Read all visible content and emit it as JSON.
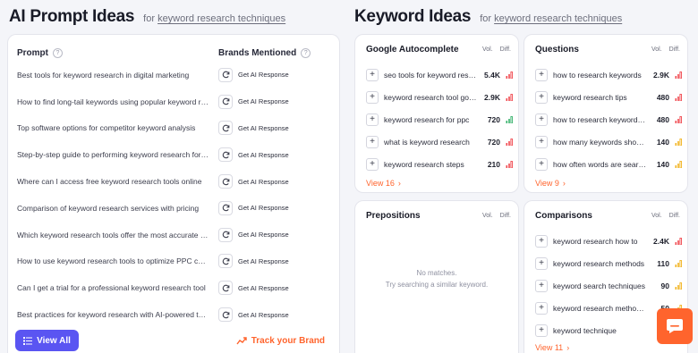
{
  "ai_prompt": {
    "title": "AI Prompt Ideas",
    "for_prefix": "for",
    "keyword": "keyword research techniques",
    "col_prompt": "Prompt",
    "col_brands": "Brands Mentioned",
    "get_response": "Get AI Response",
    "rows": [
      "Best tools for keyword research in digital marketing",
      "How to find long-tail keywords using popular keyword research tools",
      "Top software options for competitor keyword analysis",
      "Step-by-step guide to performing keyword research for SEO",
      "Where can I access free keyword research tools online",
      "Comparison of keyword research services with pricing",
      "Which keyword research tools offer the most accurate data",
      "How to use keyword research tools to optimize PPC campaigns",
      "Can I get a trial for a professional keyword research tool",
      "Best practices for keyword research with AI-powered tools"
    ],
    "view_all": "View All",
    "track_brand": "Track your Brand"
  },
  "keyword_ideas": {
    "title": "Keyword Ideas",
    "for_prefix": "for",
    "keyword": "keyword research techniques",
    "vol_label": "Vol.",
    "diff_label": "Diff.",
    "cards": {
      "autocomplete": {
        "title": "Google Autocomplete",
        "rows": [
          {
            "kw": "seo tools for keyword research",
            "vol": "5.4K",
            "diff": "red"
          },
          {
            "kw": "keyword research tool google",
            "vol": "2.9K",
            "diff": "red"
          },
          {
            "kw": "keyword research for ppc",
            "vol": "720",
            "diff": "green"
          },
          {
            "kw": "what is keyword research",
            "vol": "720",
            "diff": "red"
          },
          {
            "kw": "keyword research steps",
            "vol": "210",
            "diff": "red"
          }
        ],
        "view_more": "View 16"
      },
      "questions": {
        "title": "Questions",
        "rows": [
          {
            "kw": "how to research keywords",
            "vol": "2.9K",
            "diff": "red"
          },
          {
            "kw": "keyword research tips",
            "vol": "480",
            "diff": "red"
          },
          {
            "kw": "how to research keywords for seo",
            "vol": "480",
            "diff": "red"
          },
          {
            "kw": "how many keywords should i use",
            "vol": "140",
            "diff": "yellow"
          },
          {
            "kw": "how often words are searched",
            "vol": "140",
            "diff": "yellow"
          }
        ],
        "view_more": "View 9"
      },
      "prepositions": {
        "title": "Prepositions",
        "no_matches": "No matches.",
        "try_similar": "Try searching a similar keyword."
      },
      "comparisons": {
        "title": "Comparisons",
        "rows": [
          {
            "kw": "keyword research how to",
            "vol": "2.4K",
            "diff": "red"
          },
          {
            "kw": "keyword research methods",
            "vol": "110",
            "diff": "yellow"
          },
          {
            "kw": "keyword search techniques",
            "vol": "90",
            "diff": "yellow"
          },
          {
            "kw": "keyword research methodology",
            "vol": "50",
            "diff": "yellow"
          },
          {
            "kw": "keyword technique",
            "vol": "30",
            "diff": "yellow"
          }
        ],
        "view_more": "View 11"
      }
    }
  },
  "colors": {
    "accent": "#ff642d",
    "primary": "#5a55f2",
    "diff_red": "#f0494f",
    "diff_green": "#37b26b",
    "diff_yellow": "#f2b31f"
  }
}
